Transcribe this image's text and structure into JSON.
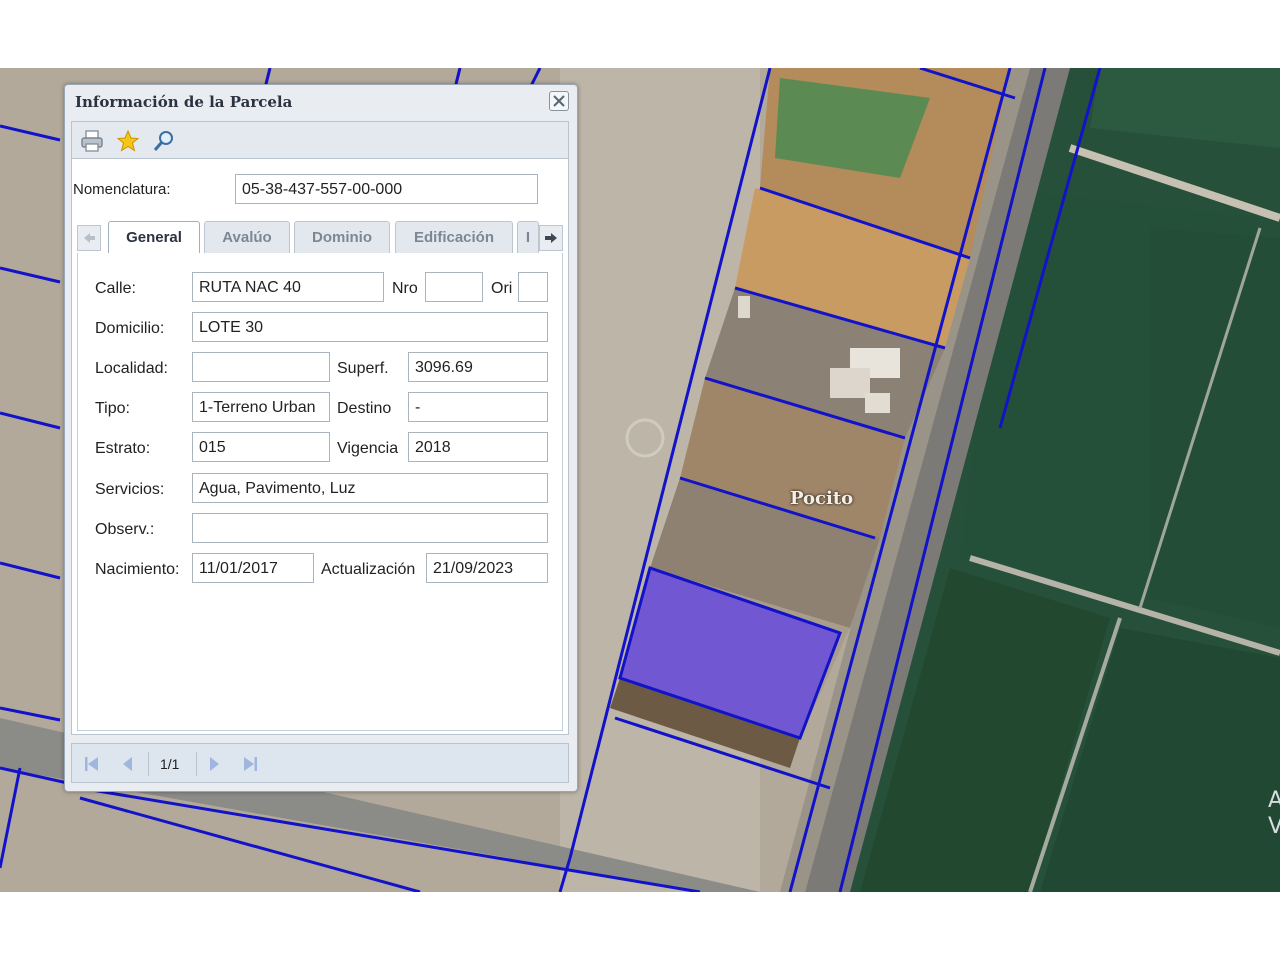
{
  "window": {
    "title": "Información de la Parcela",
    "toolbar": {
      "print": "printer-icon",
      "favorite": "star-icon",
      "zoom": "magnifier-icon"
    },
    "nomenclatura": {
      "label": "Nomenclatura:",
      "value": "05-38-437-557-00-000"
    },
    "tabs": [
      {
        "label": "General",
        "active": true
      },
      {
        "label": "Avalúo",
        "active": false
      },
      {
        "label": "Dominio",
        "active": false
      },
      {
        "label": "Edificación",
        "active": false
      },
      {
        "label": "I",
        "active": false
      }
    ],
    "form": {
      "calle": {
        "label": "Calle:",
        "value": "RUTA NAC 40"
      },
      "nro": {
        "label": "Nro",
        "value": ""
      },
      "ori": {
        "label": "Ori",
        "value": ""
      },
      "domicilio": {
        "label": "Domicilio:",
        "value": "LOTE 30"
      },
      "localidad": {
        "label": "Localidad:",
        "value": ""
      },
      "superf": {
        "label": "Superf.",
        "value": "3096.69"
      },
      "tipo": {
        "label": "Tipo:",
        "value": "1-Terreno Urban"
      },
      "destino": {
        "label": "Destino",
        "value": "-"
      },
      "estrato": {
        "label": "Estrato:",
        "value": "015"
      },
      "vigencia": {
        "label": "Vigencia",
        "value": "2018"
      },
      "servicios": {
        "label": "Servicios:",
        "value": "Agua, Pavimento, Luz"
      },
      "observ": {
        "label": "Observ.:",
        "value": ""
      },
      "nacimiento": {
        "label": "Nacimiento:",
        "value": "11/01/2017"
      },
      "actualizacion": {
        "label": "Actualización",
        "value": "21/09/2023"
      }
    },
    "pager": {
      "page": "1/1"
    }
  },
  "map": {
    "place_label": "Pocito",
    "edge_text": "A\nV",
    "colors": {
      "parcel_line": "#1010c8",
      "selected_fill": "#5a3cf0",
      "field_green": "#234a36"
    }
  }
}
